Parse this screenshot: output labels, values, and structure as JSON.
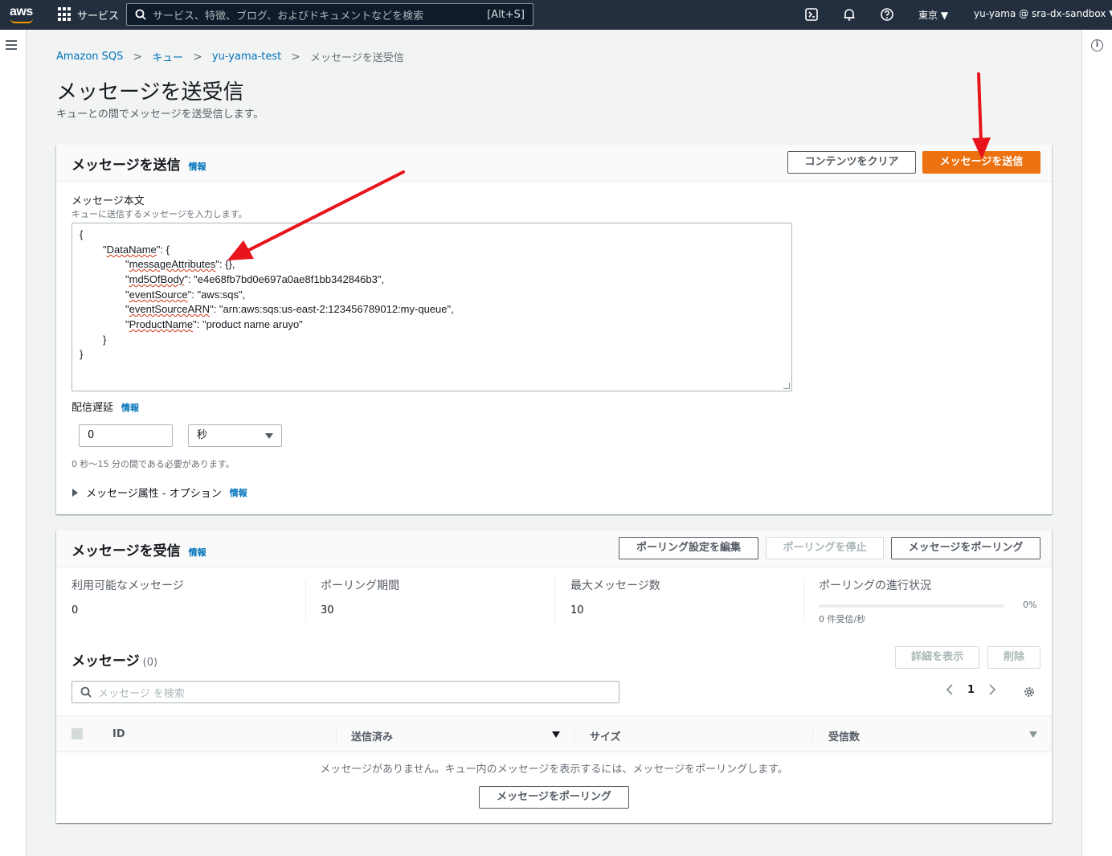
{
  "topnav": {
    "logo_text": "aws",
    "services_label": "サービス",
    "search_placeholder": "サービス、特徴、ブログ、およびドキュメントなどを検索",
    "search_hint": "[Alt+S]",
    "region": "東京 ▼",
    "account": "yu-yama @ sra-dx-sandbox ▼"
  },
  "breadcrumb": [
    "Amazon SQS",
    "キュー",
    "yu-yama-test",
    "メッセージを送受信"
  ],
  "page": {
    "title": "メッセージを送受信",
    "subtitle": "キューとの間でメッセージを送受信します。"
  },
  "send": {
    "title": "メッセージを送信",
    "info": "情報",
    "clear_button": "コンテンツをクリア",
    "send_button": "メッセージを送信",
    "body_label": "メッセージ本文",
    "body_desc": "キューに送信するメッセージを入力します。",
    "body_lines": [
      "{",
      "\"DataName\": {",
      "\"messageAttributes\": {},",
      "\"md5OfBody\": \"e4e68fb7bd0e697a0ae8f1bb342846b3\",",
      "\"eventSource\": \"aws:sqs\",",
      "\"eventSourceARN\": \"arn:aws:sqs:us-east-2:123456789012:my-queue\",",
      "\"ProductName\": \"product name aruyo\"",
      "}",
      "}"
    ],
    "delay_label": "配信遅延",
    "delay_info": "情報",
    "delay_value": "0",
    "delay_unit": "秒",
    "delay_desc": "0 秒～15 分の間である必要があります。",
    "attributes_label": "メッセージ属性 - オプション",
    "attributes_info": "情報"
  },
  "receive": {
    "title": "メッセージを受信",
    "info": "情報",
    "edit_polling_button": "ポーリング設定を編集",
    "stop_polling_button": "ポーリングを停止",
    "poll_button": "メッセージをポーリング",
    "stats": [
      {
        "label": "利用可能なメッセージ",
        "value": "0"
      },
      {
        "label": "ポーリング期間",
        "value": "30"
      },
      {
        "label": "最大メッセージ数",
        "value": "10"
      }
    ],
    "progress_label": "ポーリングの進行状況",
    "progress_percent": "0%",
    "progress_value": 0,
    "progress_rate": "0 件受信/秒"
  },
  "messages": {
    "title": "メッセージ",
    "count": "(0)",
    "details_button": "詳細を表示",
    "delete_button": "削除",
    "search_placeholder": "メッセージ を検索",
    "page_number": "1",
    "columns": [
      "ID",
      "送信済み",
      "サイズ",
      "受信数"
    ],
    "empty_text": "メッセージがありません。キュー内のメッセージを表示するには、メッセージをポーリングします。",
    "empty_poll_button": "メッセージをポーリング"
  },
  "colors": {
    "nav_bg": "#232f3e",
    "primary": "#ec7211",
    "link": "#0073bb",
    "annotation_arrow": "#e8141c"
  }
}
